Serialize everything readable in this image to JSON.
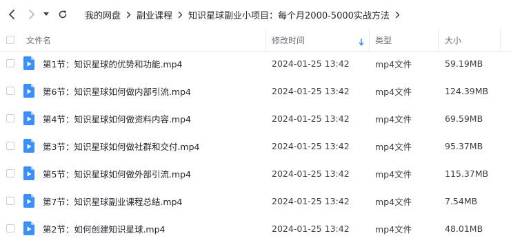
{
  "nav": {
    "back_icon": "chevron-left-icon",
    "forward_icon": "chevron-right-icon",
    "history_icon": "caret-down-icon",
    "refresh_icon": "refresh-icon"
  },
  "breadcrumb": [
    "我的网盘",
    "副业课程",
    "知识星球副业小项目：每个月2000-5000实战方法"
  ],
  "columns": {
    "name": "文件名",
    "modified": "修改时间",
    "type": "类型",
    "size": "大小",
    "sort_icon": "sort-down-arrow-icon"
  },
  "colors": {
    "accent": "#2f8cff",
    "file_icon": "#3b8ff6"
  },
  "files": [
    {
      "name": "第1节：知识星球的优势和功能.mp4",
      "modified": "2024-01-25 13:42",
      "type": "mp4文件",
      "size": "59.19MB"
    },
    {
      "name": "第6节：知识星球如何做内部引流.mp4",
      "modified": "2024-01-25 13:42",
      "type": "mp4文件",
      "size": "124.39MB"
    },
    {
      "name": "第4节：知识星球如何做资料内容.mp4",
      "modified": "2024-01-25 13:42",
      "type": "mp4文件",
      "size": "69.59MB"
    },
    {
      "name": "第3节：知识星球如何做社群和交付.mp4",
      "modified": "2024-01-25 13:42",
      "type": "mp4文件",
      "size": "95.37MB"
    },
    {
      "name": "第5节：知识星球如何做外部引流.mp4",
      "modified": "2024-01-25 13:42",
      "type": "mp4文件",
      "size": "115.37MB"
    },
    {
      "name": "第7节：知识星球副业课程总结.mp4",
      "modified": "2024-01-25 13:42",
      "type": "mp4文件",
      "size": "7.54MB"
    },
    {
      "name": "第2节：如何创建知识星球.mp4",
      "modified": "2024-01-25 13:42",
      "type": "mp4文件",
      "size": "48.01MB"
    }
  ]
}
